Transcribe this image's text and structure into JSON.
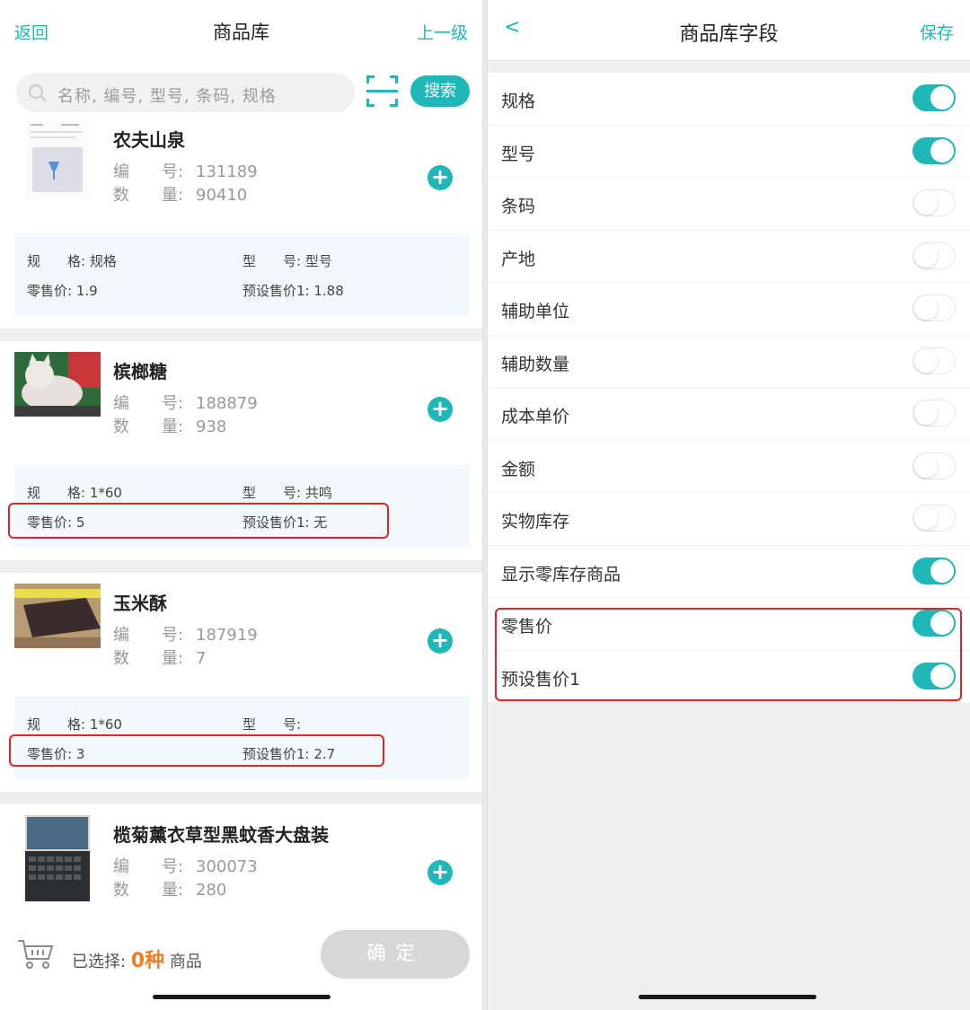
{
  "left": {
    "nav": {
      "back": "返回",
      "title": "商品库",
      "up": "上一级"
    },
    "search": {
      "placeholder": "名称, 编号, 型号, 条码, 规格",
      "button": "搜索"
    },
    "labels": {
      "code": "编　　号: ",
      "qty": "数　　量: ",
      "spec": "规　　格: ",
      "model": "型　　号: ",
      "retail": "零售价: ",
      "preset": "预设售价1: "
    },
    "products": [
      {
        "name": "农夫山泉",
        "code": "131189",
        "qty": "90410",
        "spec": "规格",
        "model": "型号",
        "retail": "1.9",
        "preset": "1.88"
      },
      {
        "name": "槟榔糖",
        "code": "188879",
        "qty": "938",
        "spec": "1*60",
        "model": "共鸣",
        "retail": "5",
        "preset": "无"
      },
      {
        "name": "玉米酥",
        "code": "187919",
        "qty": "7",
        "spec": "1*60",
        "model": "",
        "retail": "3",
        "preset": "2.7"
      },
      {
        "name": "榄菊薰衣草型黑蚊香大盘装",
        "code": "300073",
        "qty": "280"
      }
    ],
    "footer": {
      "selected_prefix": "已选择: ",
      "selected_count": "0种",
      "selected_suffix": " 商品",
      "confirm": "确定"
    }
  },
  "right": {
    "nav": {
      "back": "<",
      "title": "商品库字段",
      "save": "保存"
    },
    "fields": [
      {
        "label": "规格",
        "on": true
      },
      {
        "label": "型号",
        "on": true
      },
      {
        "label": "条码",
        "on": false
      },
      {
        "label": "产地",
        "on": false
      },
      {
        "label": "辅助单位",
        "on": false
      },
      {
        "label": "辅助数量",
        "on": false
      },
      {
        "label": "成本单价",
        "on": false
      },
      {
        "label": "金额",
        "on": false
      },
      {
        "label": "实物库存",
        "on": false
      },
      {
        "label": "显示零库存商品",
        "on": true
      },
      {
        "label": "零售价",
        "on": true
      },
      {
        "label": "预设售价1",
        "on": true
      }
    ]
  },
  "colors": {
    "accent": "#1fb7b7",
    "highlight": "#e32424",
    "count": "#f07c28"
  }
}
